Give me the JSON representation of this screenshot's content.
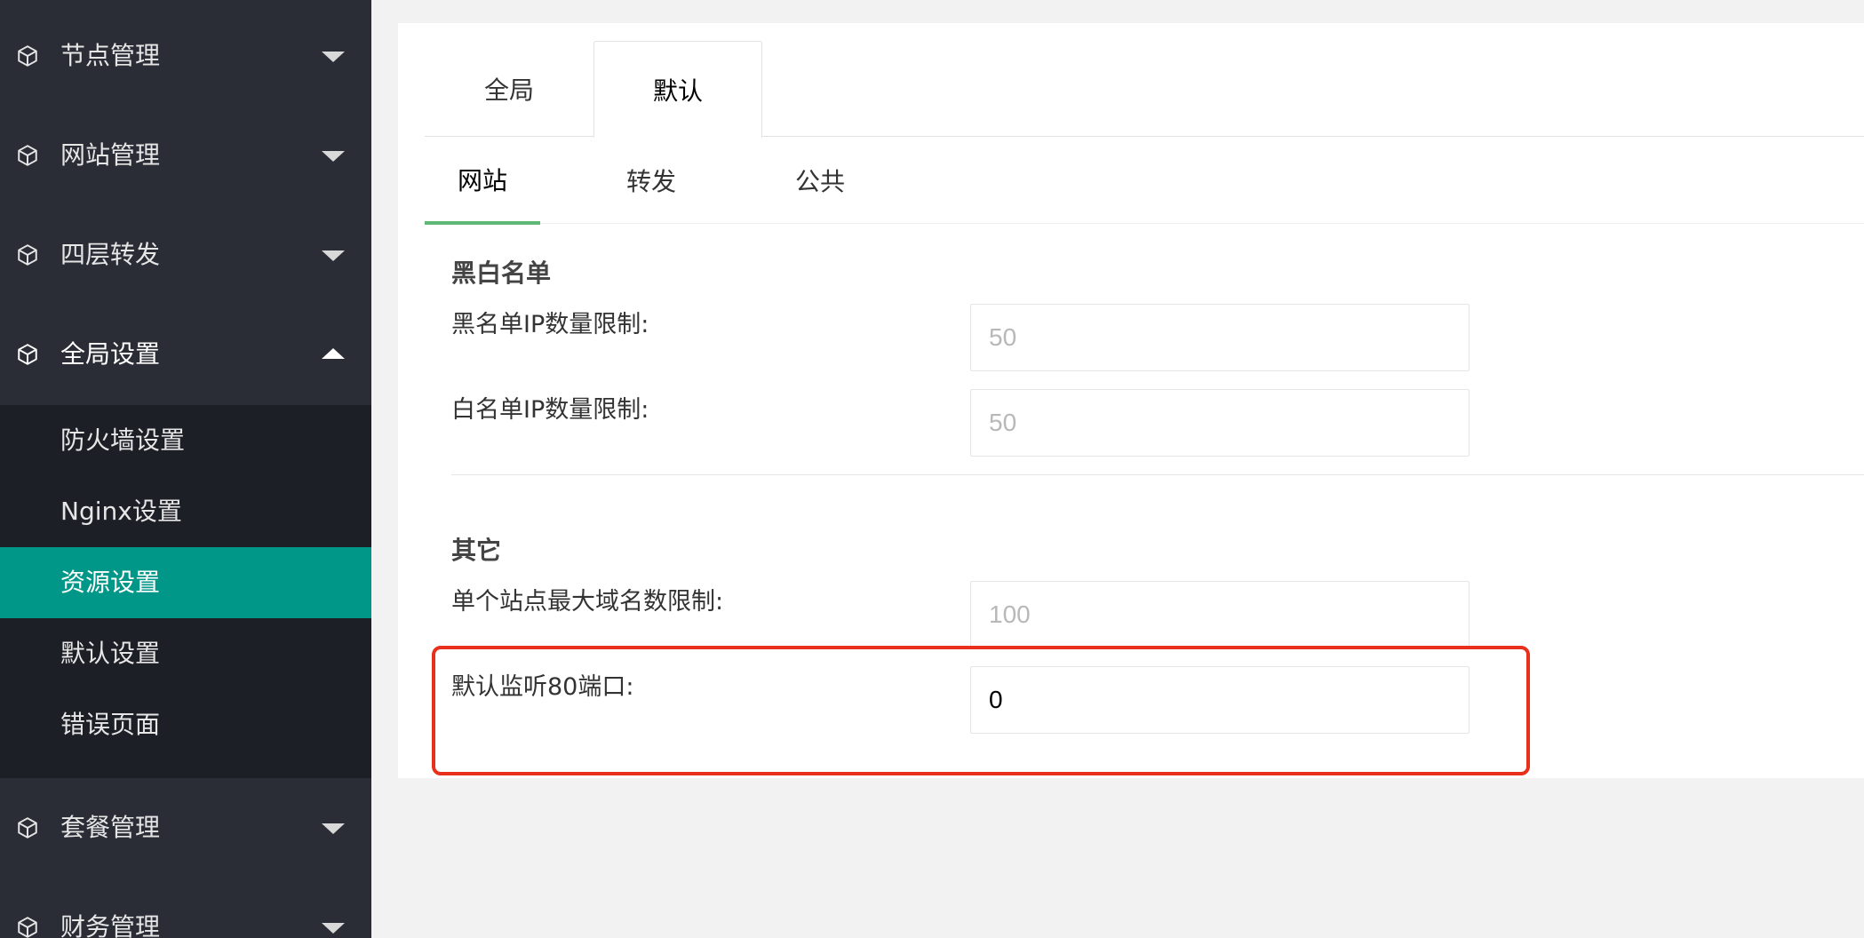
{
  "sidebar": {
    "menus": [
      {
        "label": "节点管理",
        "icon": "cube-icon",
        "caret": "down"
      },
      {
        "label": "网站管理",
        "icon": "cube-icon",
        "caret": "down"
      },
      {
        "label": "四层转发",
        "icon": "cube-icon",
        "caret": "down"
      },
      {
        "label": "全局设置",
        "icon": "cube-icon",
        "caret": "up"
      },
      {
        "label": "套餐管理",
        "icon": "cube-icon",
        "caret": "down"
      },
      {
        "label": "财务管理",
        "icon": "cube-icon",
        "caret": "down"
      }
    ],
    "submenu": [
      {
        "label": "防火墙设置"
      },
      {
        "label": "Nginx设置"
      },
      {
        "label": "资源设置",
        "active": true
      },
      {
        "label": "默认设置"
      },
      {
        "label": "错误页面"
      }
    ],
    "active_color": "#009688"
  },
  "main": {
    "top_tabs": [
      {
        "label": "全局"
      },
      {
        "label": "默认",
        "active": true
      }
    ],
    "sub_tabs": [
      {
        "label": "网站",
        "active": true
      },
      {
        "label": "转发"
      },
      {
        "label": "公共"
      }
    ],
    "sections": [
      {
        "title": "黑白名单",
        "fields": [
          {
            "label": "黑名单IP数量限制:",
            "placeholder": "50",
            "value": ""
          },
          {
            "label": "白名单IP数量限制:",
            "placeholder": "50",
            "value": ""
          }
        ]
      },
      {
        "title": "其它",
        "fields": [
          {
            "label": "单个站点最大域名数限制:",
            "placeholder": "100",
            "value": ""
          },
          {
            "label": "默认监听80端口:",
            "placeholder": "",
            "value": "0"
          }
        ]
      }
    ],
    "accent_color": "#5fb878",
    "highlight_color": "#e8301c"
  }
}
